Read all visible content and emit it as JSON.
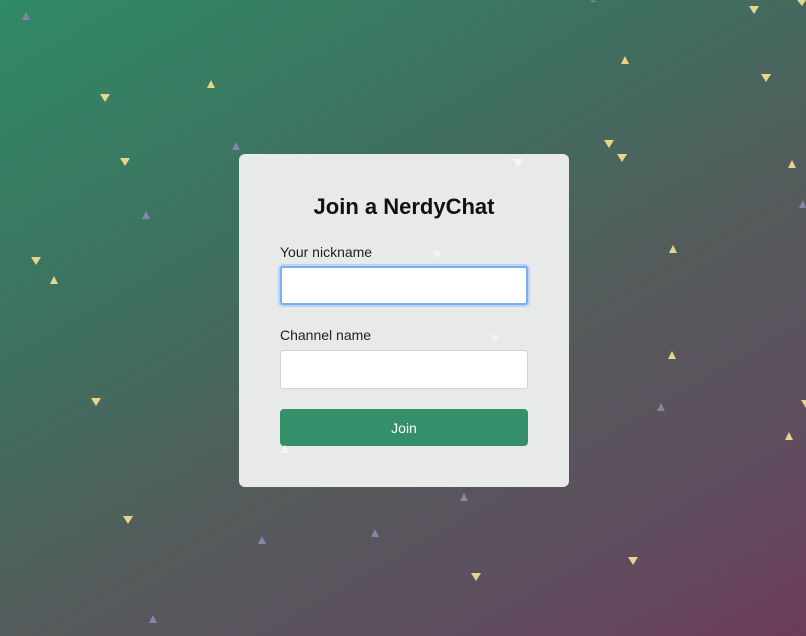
{
  "form": {
    "title": "Join a NerdyChat",
    "nickname_label": "Your nickname",
    "nickname_value": "",
    "channel_label": "Channel name",
    "channel_value": "",
    "join_label": "Join"
  },
  "colors": {
    "accent": "#33906a",
    "focus_ring": "#7aaef0",
    "card_background": "#e8e9e9",
    "gradient_start": "#2f8a66",
    "gradient_end": "#6c3b5a",
    "triangle_yellow": "#e8d48a",
    "triangle_purple": "#8a83a8",
    "triangle_white": "#f2f2f2"
  },
  "decorations": {
    "icon": "triangle-icon"
  }
}
